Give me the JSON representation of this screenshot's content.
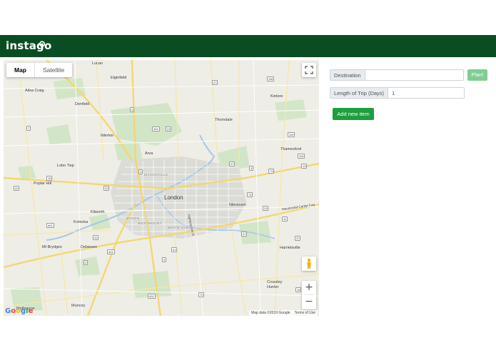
{
  "header": {
    "brand": "instago",
    "brand_color": "#0b4d23"
  },
  "map": {
    "type_controls": [
      "Map",
      "Satellite"
    ],
    "active_type": "Map",
    "city_labels": [
      "Lucan",
      "Elginfield",
      "Ailsa Craig",
      "Denfield",
      "Kintore",
      "Thorndale",
      "Ilderton",
      "Arva",
      "Thamesford",
      "Lobo Twp",
      "Poplar Hill",
      "London",
      "Nilestown",
      "Kilworth",
      "Komoka",
      "Mt Brydges",
      "Delaware",
      "Harrietsville",
      "Crossley Hunter",
      "Muncey",
      "Melbourne"
    ],
    "neighbourhood_labels": [
      "MASONVILLE",
      "BYRON",
      "WESTMOUNT",
      "WHITE OAKS"
    ],
    "road_labels": [
      "Highbury Ave N",
      "Macdonald-Cartier Fwy"
    ],
    "route_numbers": [
      "4",
      "7",
      "2",
      "3",
      "20",
      "22",
      "23",
      "27",
      "73",
      "74",
      "118",
      "119",
      "401",
      "402",
      "41",
      "10",
      "16",
      "11",
      "72",
      "13",
      "15",
      "37"
    ],
    "google": "Google",
    "attribution": "Map data ©2019 Google",
    "terms": "Terms of Use",
    "zoom_in": "+",
    "zoom_out": "−"
  },
  "form": {
    "destination_label": "Destination",
    "destination_value": "",
    "plan_label": "Plan!",
    "length_label": "Length of Trip (Days)",
    "length_value": "1",
    "add_item_label": "Add new item"
  }
}
